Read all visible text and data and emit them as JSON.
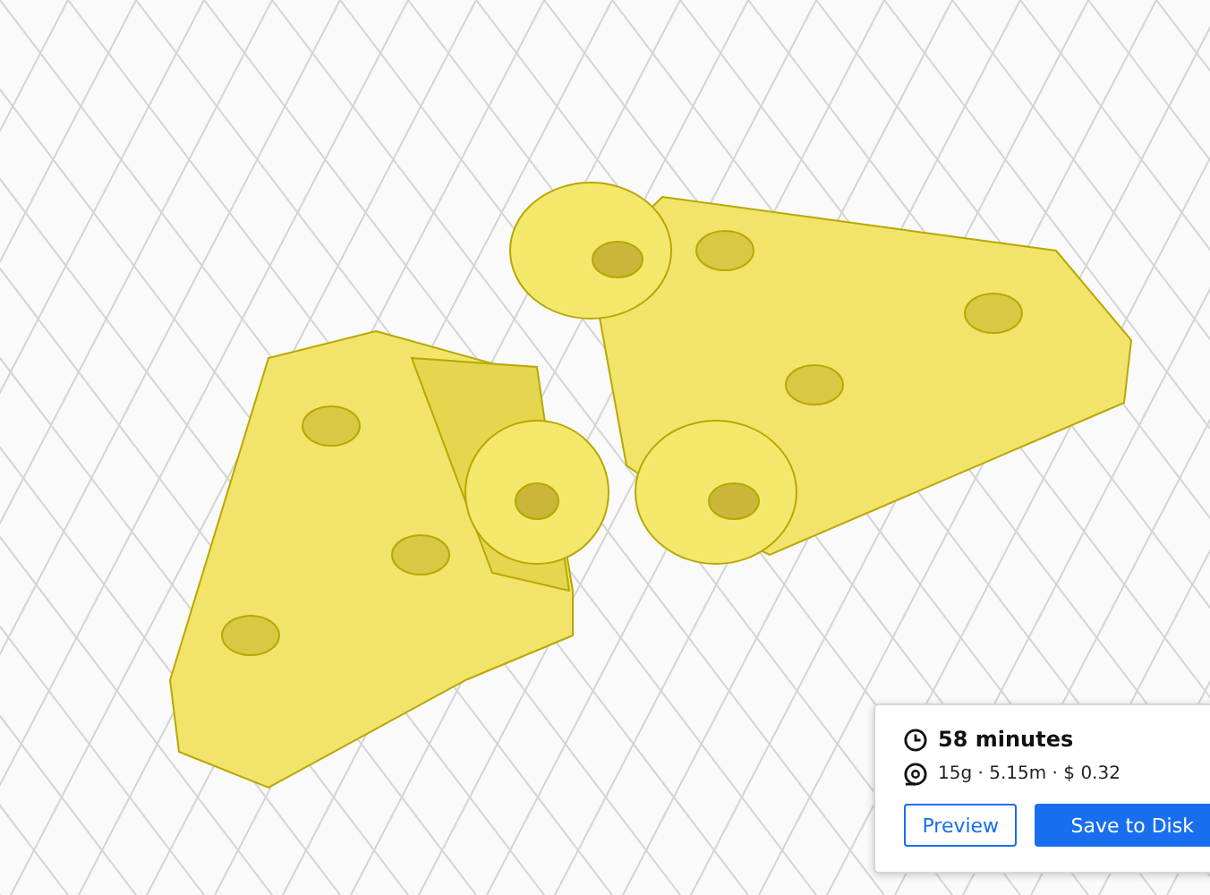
{
  "print_summary": {
    "time": "58 minutes",
    "details": "15g · 5.15m · $ 0.32"
  },
  "buttons": [
    {
      "label": "Preview",
      "kind": "outline"
    },
    {
      "label": "Save to Disk",
      "kind": "primary"
    }
  ]
}
